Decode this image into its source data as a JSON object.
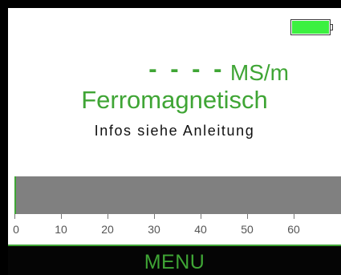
{
  "status": {
    "battery_icon": "battery-full-icon",
    "battery_level": 1.0,
    "battery_color": "#3cf040"
  },
  "measurement": {
    "value": "- - - -",
    "unit": "MS/m",
    "material": "Ferromagnetisch",
    "hint": "Infos siehe Anleitung"
  },
  "scale": {
    "bar_value": 0,
    "min": 0,
    "max": 70,
    "ticks": [
      "0",
      "10",
      "20",
      "30",
      "40",
      "50",
      "60"
    ],
    "bar_color": "#808080",
    "accent_color": "#3fa535"
  },
  "softkey": {
    "label": "MENU"
  }
}
